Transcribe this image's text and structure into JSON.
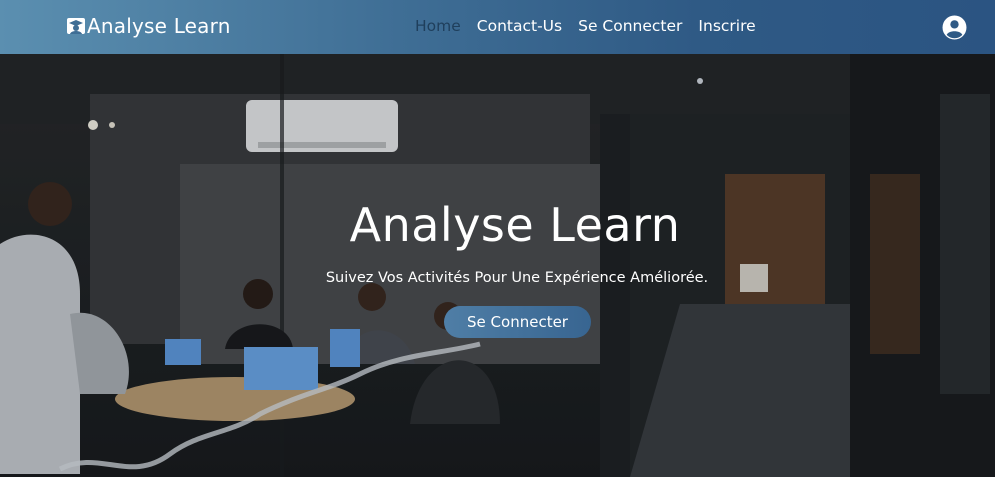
{
  "brand": {
    "name": "Analyse Learn",
    "icon": "graduate-icon"
  },
  "nav": {
    "links": [
      {
        "label": "Home",
        "active": true
      },
      {
        "label": "Contact-Us",
        "active": false
      },
      {
        "label": "Se Connecter",
        "active": false
      },
      {
        "label": "Inscrire",
        "active": false
      }
    ],
    "user_icon": "user-circle-icon"
  },
  "hero": {
    "title": "Analyse Learn",
    "subtitle": "Suivez Vos Activités Pour Une Expérience Améliorée.",
    "button_label": "Se Connecter",
    "background": "office-meeting-photo"
  },
  "colors": {
    "navbar_start": "#5b8fb0",
    "navbar_end": "#2b5482",
    "active_link": "#1f3f5c",
    "button": "#4577a0"
  }
}
